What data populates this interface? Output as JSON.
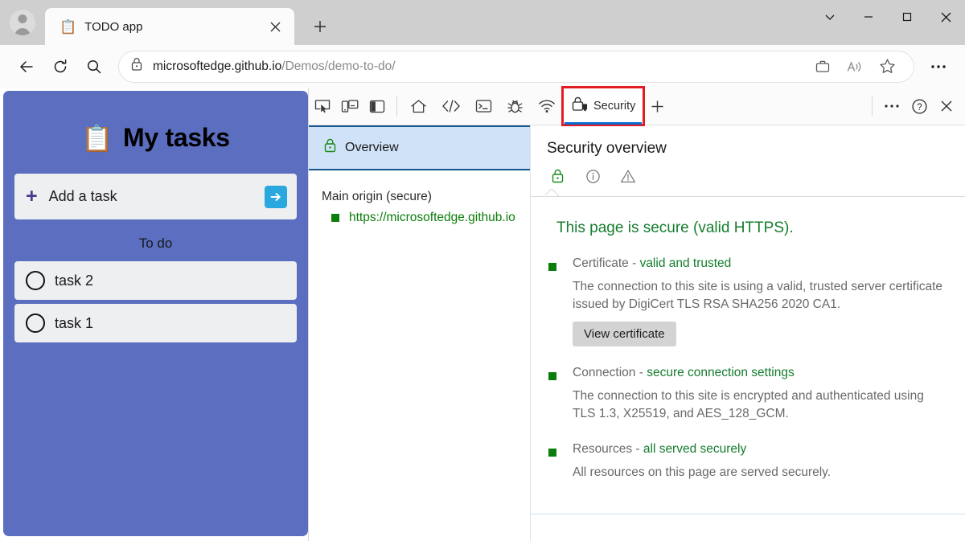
{
  "window": {
    "controls": {
      "more_label": "⌄",
      "minimize_label": "—",
      "maximize_label": "□",
      "close_label": "✕"
    }
  },
  "tabs": {
    "active": {
      "favicon": "clipboard-icon",
      "title": "TODO app",
      "close_label": "✕"
    },
    "new_tab_label": "+"
  },
  "navbar": {
    "back_icon": "back-arrow-icon",
    "reload_icon": "reload-icon",
    "search_icon": "search-icon",
    "lock_icon": "lock-icon",
    "url_domain": "microsoftedge.github.io",
    "url_path": "/Demos/demo-to-do/",
    "collections_icon": "briefcase-icon",
    "read_aloud_icon": "read-aloud-icon",
    "favorites_icon": "star-icon",
    "settings_icon": "ellipsis-icon"
  },
  "todo": {
    "clipboard": "📋",
    "title": "My tasks",
    "add_plus": "+",
    "add_placeholder": "Add a task",
    "submit_icon": "arrow-right-icon",
    "section_label": "To do",
    "tasks": [
      {
        "label": "task 2",
        "done": false
      },
      {
        "label": "task 1",
        "done": false
      }
    ]
  },
  "devtools": {
    "toolbar": {
      "inspect_icon": "inspect-element-icon",
      "device_icon": "device-emulation-icon",
      "dock_icon": "dock-side-icon",
      "tabs": [
        {
          "name": "welcome",
          "icon": "home-icon",
          "label": "",
          "active": false
        },
        {
          "name": "elements",
          "icon": "elements-icon",
          "label": "",
          "active": false
        },
        {
          "name": "console",
          "icon": "console-icon",
          "label": "",
          "active": false
        },
        {
          "name": "sources",
          "icon": "sources-bug-icon",
          "label": "",
          "active": false
        },
        {
          "name": "network",
          "icon": "network-wifi-icon",
          "label": "",
          "active": false
        },
        {
          "name": "security",
          "icon": "security-lock-shield-icon",
          "label": "Security",
          "active": true
        }
      ],
      "add_tab_label": "+",
      "more_label": "⋯",
      "help_label": "?",
      "close_label": "✕",
      "highlight_color": "#e31b23",
      "active_underline_color": "#0a6cd0"
    },
    "sidebar": {
      "overview_icon": "green-lock-icon",
      "overview_label": "Overview",
      "group_title": "Main origin (secure)",
      "origins": [
        {
          "url": "https://microsoftedge.github.io",
          "state": "secure"
        }
      ]
    },
    "main": {
      "title": "Security overview",
      "state_icons": [
        {
          "name": "secure-lock-icon",
          "active": true
        },
        {
          "name": "info-circle-icon",
          "active": false
        },
        {
          "name": "warning-triangle-icon",
          "active": false
        }
      ],
      "headline": "This page is secure (valid HTTPS).",
      "blocks": [
        {
          "name": "certificate",
          "label": "Certificate - ",
          "status": "valid and trusted",
          "description": "The connection to this site is using a valid, trusted server certificate issued by DigiCert TLS RSA SHA256 2020 CA1.",
          "button": "View certificate"
        },
        {
          "name": "connection",
          "label": "Connection - ",
          "status": "secure connection settings",
          "description": "The connection to this site is encrypted and authenticated using TLS 1.3, X25519, and AES_128_GCM.",
          "button": null
        },
        {
          "name": "resources",
          "label": "Resources - ",
          "status": "all served securely",
          "description": "All resources on this page are served securely.",
          "button": null
        }
      ]
    }
  },
  "colors": {
    "todo_bg": "#5b6ec0",
    "secure_green": "#0a7d0a",
    "accent_blue": "#0a6cd0",
    "annotation_red": "#e31b23",
    "submit_blue": "#29a8e0"
  }
}
